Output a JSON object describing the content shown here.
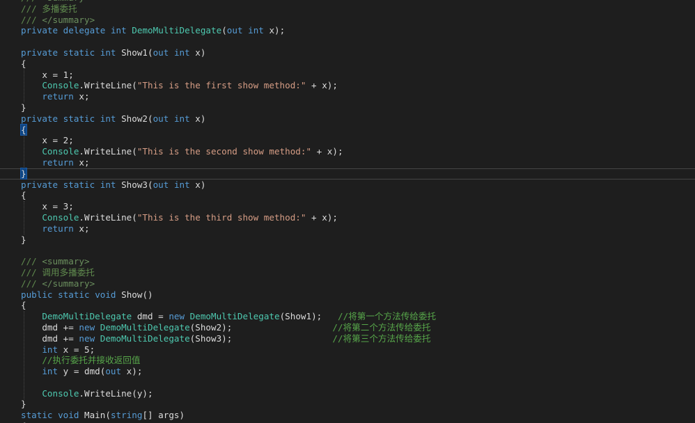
{
  "colors": {
    "background": "#1e1e1e",
    "keyword": "#569cd6",
    "type": "#4ec9b0",
    "string": "#d69d85",
    "comment": "#57a64a",
    "doc_comment": "#608b4e",
    "plain": "#dcdcdc"
  },
  "lines": [
    [
      {
        "t": "/// ",
        "c": "doc"
      },
      {
        "t": "<summary>",
        "c": "xml"
      }
    ],
    [
      {
        "t": "/// 多播委托",
        "c": "doc"
      }
    ],
    [
      {
        "t": "/// ",
        "c": "doc"
      },
      {
        "t": "</summary>",
        "c": "xml"
      }
    ],
    [
      {
        "t": "private",
        "c": "kw"
      },
      {
        "t": " ",
        "c": "plain"
      },
      {
        "t": "delegate",
        "c": "kw"
      },
      {
        "t": " ",
        "c": "plain"
      },
      {
        "t": "int",
        "c": "kw"
      },
      {
        "t": " ",
        "c": "plain"
      },
      {
        "t": "DemoMultiDelegate",
        "c": "type"
      },
      {
        "t": "(",
        "c": "plain"
      },
      {
        "t": "out",
        "c": "kw"
      },
      {
        "t": " ",
        "c": "plain"
      },
      {
        "t": "int",
        "c": "kw"
      },
      {
        "t": " x);",
        "c": "plain"
      }
    ],
    [],
    [
      {
        "t": "private",
        "c": "kw"
      },
      {
        "t": " ",
        "c": "plain"
      },
      {
        "t": "static",
        "c": "kw"
      },
      {
        "t": " ",
        "c": "plain"
      },
      {
        "t": "int",
        "c": "kw"
      },
      {
        "t": " Show1(",
        "c": "plain"
      },
      {
        "t": "out",
        "c": "kw"
      },
      {
        "t": " ",
        "c": "plain"
      },
      {
        "t": "int",
        "c": "kw"
      },
      {
        "t": " x)",
        "c": "plain"
      }
    ],
    [
      {
        "t": "{",
        "c": "plain"
      }
    ],
    [
      {
        "t": "    x = 1;",
        "c": "plain"
      }
    ],
    [
      {
        "t": "    ",
        "c": "plain"
      },
      {
        "t": "Console",
        "c": "type"
      },
      {
        "t": ".WriteLine(",
        "c": "plain"
      },
      {
        "t": "\"This is the first show method:\"",
        "c": "str"
      },
      {
        "t": " + x);",
        "c": "plain"
      }
    ],
    [
      {
        "t": "    ",
        "c": "plain"
      },
      {
        "t": "return",
        "c": "kw"
      },
      {
        "t": " x;",
        "c": "plain"
      }
    ],
    [
      {
        "t": "}",
        "c": "plain"
      }
    ],
    [
      {
        "t": "private",
        "c": "kw"
      },
      {
        "t": " ",
        "c": "plain"
      },
      {
        "t": "static",
        "c": "kw"
      },
      {
        "t": " ",
        "c": "plain"
      },
      {
        "t": "int",
        "c": "kw"
      },
      {
        "t": " Show2(",
        "c": "plain"
      },
      {
        "t": "out",
        "c": "kw"
      },
      {
        "t": " ",
        "c": "plain"
      },
      {
        "t": "int",
        "c": "kw"
      },
      {
        "t": " x)",
        "c": "plain"
      }
    ],
    [
      {
        "t": "{",
        "c": "plain",
        "match": true
      }
    ],
    [
      {
        "t": "    x = 2;",
        "c": "plain"
      }
    ],
    [
      {
        "t": "    ",
        "c": "plain"
      },
      {
        "t": "Console",
        "c": "type"
      },
      {
        "t": ".WriteLine(",
        "c": "plain"
      },
      {
        "t": "\"This is the second show method:\"",
        "c": "str"
      },
      {
        "t": " + x);",
        "c": "plain"
      }
    ],
    [
      {
        "t": "    ",
        "c": "plain"
      },
      {
        "t": "return",
        "c": "kw"
      },
      {
        "t": " x;",
        "c": "plain"
      }
    ],
    [
      {
        "t": "}",
        "c": "plain",
        "match": true
      }
    ],
    [
      {
        "t": "private",
        "c": "kw"
      },
      {
        "t": " ",
        "c": "plain"
      },
      {
        "t": "static",
        "c": "kw"
      },
      {
        "t": " ",
        "c": "plain"
      },
      {
        "t": "int",
        "c": "kw"
      },
      {
        "t": " Show3(",
        "c": "plain"
      },
      {
        "t": "out",
        "c": "kw"
      },
      {
        "t": " ",
        "c": "plain"
      },
      {
        "t": "int",
        "c": "kw"
      },
      {
        "t": " x)",
        "c": "plain"
      }
    ],
    [
      {
        "t": "{",
        "c": "plain"
      }
    ],
    [
      {
        "t": "    x = 3;",
        "c": "plain"
      }
    ],
    [
      {
        "t": "    ",
        "c": "plain"
      },
      {
        "t": "Console",
        "c": "type"
      },
      {
        "t": ".WriteLine(",
        "c": "plain"
      },
      {
        "t": "\"This is the third show method:\"",
        "c": "str"
      },
      {
        "t": " + x);",
        "c": "plain"
      }
    ],
    [
      {
        "t": "    ",
        "c": "plain"
      },
      {
        "t": "return",
        "c": "kw"
      },
      {
        "t": " x;",
        "c": "plain"
      }
    ],
    [
      {
        "t": "}",
        "c": "plain"
      }
    ],
    [],
    [
      {
        "t": "/// ",
        "c": "doc"
      },
      {
        "t": "<summary>",
        "c": "xml"
      }
    ],
    [
      {
        "t": "/// 调用多播委托",
        "c": "doc"
      }
    ],
    [
      {
        "t": "/// ",
        "c": "doc"
      },
      {
        "t": "</summary>",
        "c": "xml"
      }
    ],
    [
      {
        "t": "public",
        "c": "kw"
      },
      {
        "t": " ",
        "c": "plain"
      },
      {
        "t": "static",
        "c": "kw"
      },
      {
        "t": " ",
        "c": "plain"
      },
      {
        "t": "void",
        "c": "kw"
      },
      {
        "t": " Show()",
        "c": "plain"
      }
    ],
    [
      {
        "t": "{",
        "c": "plain"
      }
    ],
    [
      {
        "t": "    ",
        "c": "plain"
      },
      {
        "t": "DemoMultiDelegate",
        "c": "type"
      },
      {
        "t": " dmd = ",
        "c": "plain"
      },
      {
        "t": "new",
        "c": "kw"
      },
      {
        "t": " ",
        "c": "plain"
      },
      {
        "t": "DemoMultiDelegate",
        "c": "type"
      },
      {
        "t": "(Show1);   ",
        "c": "plain"
      },
      {
        "t": "//将第一个方法传给委托",
        "c": "com"
      }
    ],
    [
      {
        "t": "    dmd += ",
        "c": "plain"
      },
      {
        "t": "new",
        "c": "kw"
      },
      {
        "t": " ",
        "c": "plain"
      },
      {
        "t": "DemoMultiDelegate",
        "c": "type"
      },
      {
        "t": "(Show2);                   ",
        "c": "plain"
      },
      {
        "t": "//将第二个方法传给委托",
        "c": "com"
      }
    ],
    [
      {
        "t": "    dmd += ",
        "c": "plain"
      },
      {
        "t": "new",
        "c": "kw"
      },
      {
        "t": " ",
        "c": "plain"
      },
      {
        "t": "DemoMultiDelegate",
        "c": "type"
      },
      {
        "t": "(Show3);                   ",
        "c": "plain"
      },
      {
        "t": "//将第三个方法传给委托",
        "c": "com"
      }
    ],
    [
      {
        "t": "    ",
        "c": "plain"
      },
      {
        "t": "int",
        "c": "kw"
      },
      {
        "t": " x = 5;",
        "c": "plain"
      }
    ],
    [
      {
        "t": "    ",
        "c": "plain"
      },
      {
        "t": "//执行委托并接收返回值",
        "c": "com"
      }
    ],
    [
      {
        "t": "    ",
        "c": "plain"
      },
      {
        "t": "int",
        "c": "kw"
      },
      {
        "t": " y = dmd(",
        "c": "plain"
      },
      {
        "t": "out",
        "c": "kw"
      },
      {
        "t": " x);",
        "c": "plain"
      }
    ],
    [],
    [
      {
        "t": "    ",
        "c": "plain"
      },
      {
        "t": "Console",
        "c": "type"
      },
      {
        "t": ".WriteLine(y);",
        "c": "plain"
      }
    ],
    [
      {
        "t": "}",
        "c": "plain"
      }
    ],
    [
      {
        "t": "static",
        "c": "kw"
      },
      {
        "t": " ",
        "c": "plain"
      },
      {
        "t": "void",
        "c": "kw"
      },
      {
        "t": " Main(",
        "c": "plain"
      },
      {
        "t": "string",
        "c": "kw"
      },
      {
        "t": "[] args)",
        "c": "plain"
      }
    ],
    [
      {
        "t": "{",
        "c": "plain"
      }
    ]
  ]
}
